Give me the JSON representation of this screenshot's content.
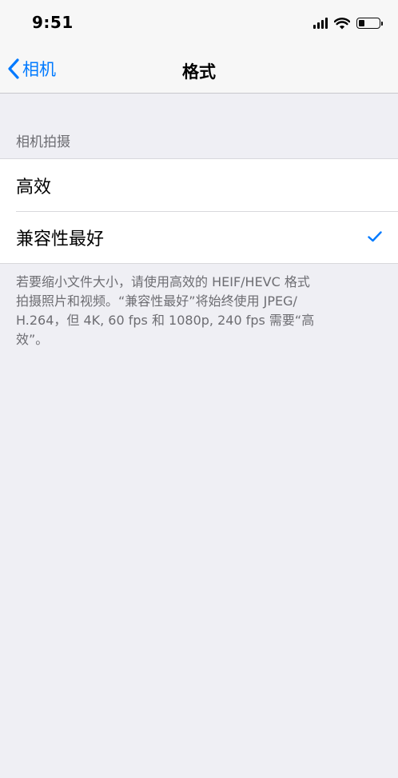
{
  "status_bar": {
    "time": "9:51"
  },
  "nav": {
    "back_label": "相机",
    "title": "格式"
  },
  "section": {
    "header": "相机拍摄",
    "options": [
      {
        "label": "高效",
        "selected": false
      },
      {
        "label": "兼容性最好",
        "selected": true
      }
    ],
    "footer_lines": [
      "若要缩小文件大小，请使用高效的 HEIF/HEVC 格式",
      "拍摄照片和视频。“兼容性最好”将始终使用 JPEG/",
      "H.264，但 4K, 60 fps 和 1080p, 240 fps 需要“高",
      "效”。"
    ]
  },
  "colors": {
    "accent": "#007aff",
    "background": "#efeff4",
    "secondary_text": "#6d6d72"
  }
}
